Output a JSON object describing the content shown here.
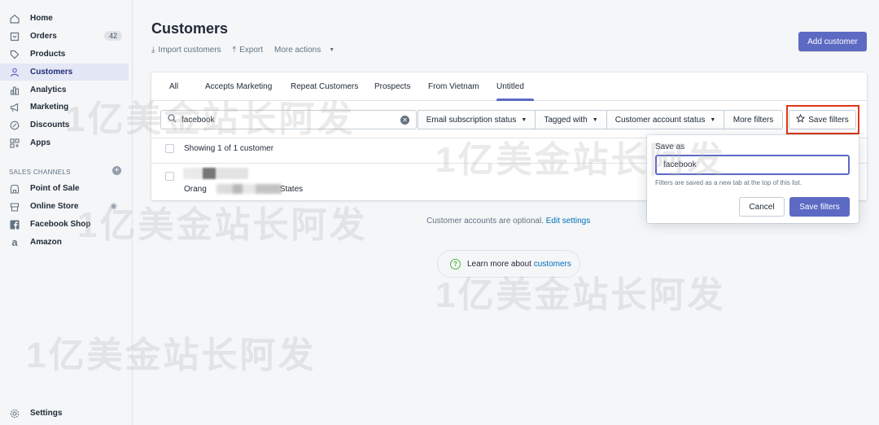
{
  "sidebar": {
    "items": [
      {
        "label": "Home",
        "icon": "home-icon"
      },
      {
        "label": "Orders",
        "icon": "orders-icon",
        "badge": "42"
      },
      {
        "label": "Products",
        "icon": "tag-icon"
      },
      {
        "label": "Customers",
        "icon": "person-icon",
        "active": true
      },
      {
        "label": "Analytics",
        "icon": "bar-chart-icon"
      },
      {
        "label": "Marketing",
        "icon": "megaphone-icon"
      },
      {
        "label": "Discounts",
        "icon": "discount-icon"
      },
      {
        "label": "Apps",
        "icon": "apps-grid-icon"
      }
    ],
    "sales_channels_title": "SALES CHANNELS",
    "channels": [
      {
        "label": "Point of Sale",
        "icon": "store-icon"
      },
      {
        "label": "Online Store",
        "icon": "online-store-icon"
      },
      {
        "label": "Facebook Shop",
        "icon": "facebook-icon"
      },
      {
        "label": "Amazon",
        "icon": "amazon-icon"
      }
    ],
    "settings_label": "Settings"
  },
  "page": {
    "title": "Customers",
    "import_label": "Import customers",
    "export_label": "Export",
    "more_actions_label": "More actions",
    "add_customer_label": "Add customer"
  },
  "tabs": [
    "All",
    "Accepts Marketing",
    "Repeat Customers",
    "Prospects",
    "From Vietnam",
    "Untitled"
  ],
  "filters": {
    "search_value": "facebook",
    "email_status_label": "Email subscription status",
    "tagged_with_label": "Tagged with",
    "account_status_label": "Customer account status",
    "more_filters_label": "More filters",
    "save_filters_label": "Save filters"
  },
  "results": {
    "showing_text": "Showing 1 of 1 customer",
    "customer_location_start": "Orang",
    "customer_location_end": "States"
  },
  "footer": {
    "accounts_note": "Customer accounts are optional.",
    "edit_settings_link": "Edit settings",
    "learn_more_text": "Learn more about",
    "learn_more_link": "customers"
  },
  "popover": {
    "label": "Save as",
    "input_value": "facebook",
    "help_text": "Filters are saved as a new tab at the top of this list.",
    "cancel_label": "Cancel",
    "save_label": "Save filters"
  },
  "watermark_text": "1亿美金站长阿发",
  "colors": {
    "primary": "#5c6ac4",
    "highlight": "#de3618",
    "link": "#006fbb"
  }
}
